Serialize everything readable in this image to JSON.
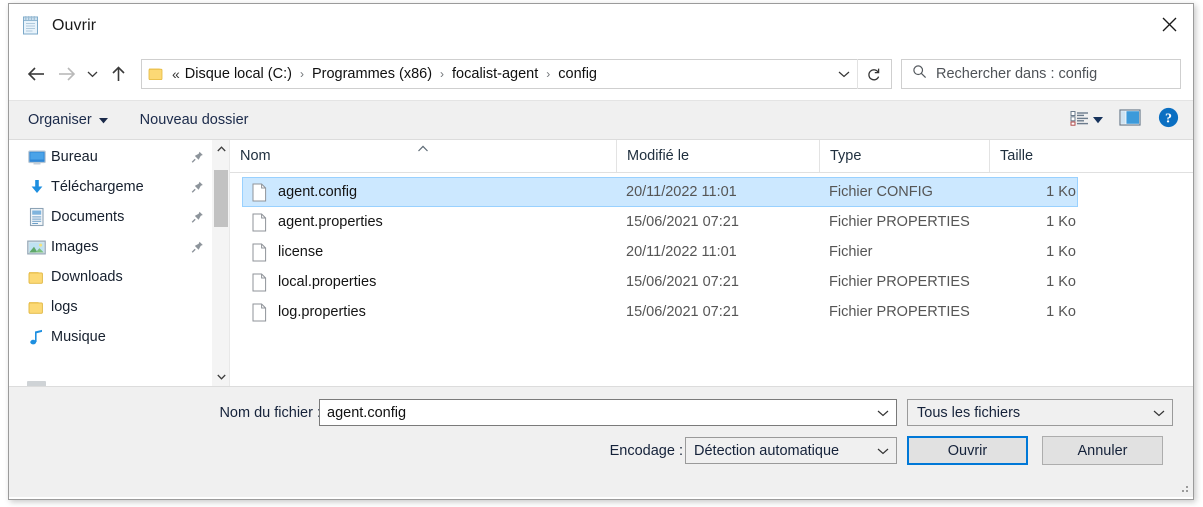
{
  "window": {
    "title": "Ouvrir",
    "title_icon": "notepad-icon",
    "close_icon": "close-icon"
  },
  "nav": {
    "back_icon": "arrow-left-icon",
    "forward_icon": "arrow-right-icon",
    "recent_icon": "chevron-down-icon",
    "up_icon": "arrow-up-icon",
    "folder_icon": "folder-icon",
    "dropdown_icon": "chevron-down-icon",
    "refresh_icon": "refresh-icon",
    "breadcrumb_lead": "«",
    "breadcrumbs": [
      "Disque local (C:)",
      "Programmes (x86)",
      "focalist-agent",
      "config"
    ],
    "breadcrumb_separator": "›"
  },
  "search": {
    "icon": "search-icon",
    "placeholder": "Rechercher dans : config"
  },
  "toolbar": {
    "organize_label": "Organiser",
    "organize_caret_icon": "caret-down-icon",
    "new_folder_label": "Nouveau dossier",
    "view_options_icon": "view-list-icon",
    "view_options_caret_icon": "caret-down-icon",
    "preview_pane_icon": "preview-pane-icon",
    "help_icon": "help-icon",
    "accent_color": "#0b6fc2"
  },
  "sidebar": {
    "items": [
      {
        "label": "Bureau",
        "icon": "desktop-icon",
        "pinned": true
      },
      {
        "label": "Téléchargeme",
        "icon": "downloads-icon",
        "pinned": true
      },
      {
        "label": "Documents",
        "icon": "documents-icon",
        "pinned": true
      },
      {
        "label": "Images",
        "icon": "pictures-icon",
        "pinned": true
      },
      {
        "label": "Downloads",
        "icon": "folder-icon",
        "pinned": false
      },
      {
        "label": "logs",
        "icon": "folder-icon",
        "pinned": false
      },
      {
        "label": "Musique",
        "icon": "music-icon",
        "pinned": false
      }
    ],
    "scroll_up_icon": "chevron-up-icon",
    "scroll_down_icon": "chevron-down-icon"
  },
  "filelist": {
    "columns": [
      {
        "label": "Nom",
        "sorted": "ascending"
      },
      {
        "label": "Modifié le",
        "sorted": ""
      },
      {
        "label": "Type",
        "sorted": ""
      },
      {
        "label": "Taille",
        "sorted": ""
      }
    ],
    "sort_caret_icon": "caret-up-icon",
    "rows": [
      {
        "name": "agent.config",
        "modified": "20/11/2022 11:01",
        "type": "Fichier CONFIG",
        "size": "1 Ko",
        "icon": "file-icon",
        "selected": true
      },
      {
        "name": "agent.properties",
        "modified": "15/06/2021 07:21",
        "type": "Fichier PROPERTIES",
        "size": "1 Ko",
        "icon": "file-icon",
        "selected": false
      },
      {
        "name": "license",
        "modified": "20/11/2022 11:01",
        "type": "Fichier",
        "size": "1 Ko",
        "icon": "file-icon",
        "selected": false
      },
      {
        "name": "local.properties",
        "modified": "15/06/2021 07:21",
        "type": "Fichier PROPERTIES",
        "size": "1 Ko",
        "icon": "file-icon",
        "selected": false
      },
      {
        "name": "log.properties",
        "modified": "15/06/2021 07:21",
        "type": "Fichier PROPERTIES",
        "size": "1 Ko",
        "icon": "file-icon",
        "selected": false
      }
    ],
    "selection_color": "#cce8ff"
  },
  "bottom": {
    "filename_label": "Nom du fichier :",
    "filename_value": "agent.config",
    "filename_dropdown_icon": "chevron-down-icon",
    "filetype_value": "Tous les fichiers",
    "filetype_dropdown_icon": "chevron-down-icon",
    "encoding_label": "Encodage :",
    "encoding_value": "Détection automatique",
    "encoding_dropdown_icon": "chevron-down-icon",
    "open_label": "Ouvrir",
    "cancel_label": "Annuler",
    "default_button_border": "#0078d7"
  }
}
